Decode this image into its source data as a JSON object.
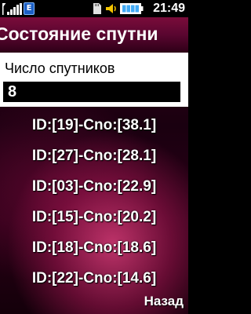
{
  "status_bar": {
    "network_icon": "signal-strength-icon",
    "data_icon": "edge-icon",
    "data_label": "E",
    "sd_icon": "sd-card-icon",
    "sound_icon": "speaker-icon",
    "battery_icon": "battery-icon",
    "time": "21:49"
  },
  "header": {
    "title": "Состояние спутни"
  },
  "satellite_count": {
    "label": "Число спутников",
    "value": "8"
  },
  "satellites": [
    {
      "text": "ID:[19]-Cno:[38.1]"
    },
    {
      "text": "ID:[27]-Cno:[28.1]"
    },
    {
      "text": "ID:[03]-Cno:[22.9]"
    },
    {
      "text": "ID:[15]-Cno:[20.2]"
    },
    {
      "text": "ID:[18]-Cno:[18.6]"
    },
    {
      "text": "ID:[22]-Cno:[14.6]"
    }
  ],
  "soft_keys": {
    "right": "Назад"
  },
  "colors": {
    "title_bar": "#5a0630",
    "background": "#2a0016",
    "accent_pink": "#d73c78",
    "battery": "#3fa9f5"
  }
}
